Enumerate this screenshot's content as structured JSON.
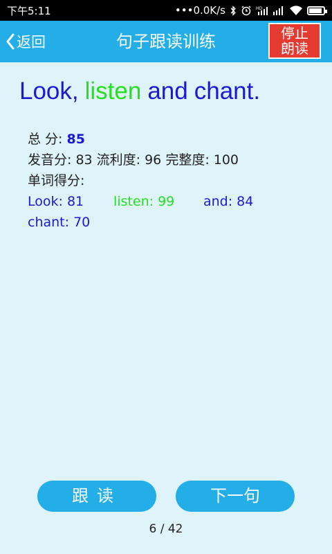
{
  "status_bar": {
    "time": "下午5:11",
    "network_speed": "0.0K/s",
    "icons": [
      "bluetooth-icon",
      "alarm-icon",
      "hd-signal-icon",
      "signal-icon",
      "wifi-icon",
      "battery-icon"
    ],
    "battery_level": 0.9
  },
  "header": {
    "back_label": "返回",
    "title": "句子跟读训练",
    "stop_line1": "停止",
    "stop_line2": "朗读"
  },
  "sentence": {
    "words": [
      {
        "text": "Look,",
        "color": "#1a1ad6"
      },
      {
        "text": "listen",
        "color": "#26e01e"
      },
      {
        "text": "and",
        "color": "#1a1ad6"
      },
      {
        "text": "chant.",
        "color": "#1a1ad6"
      }
    ]
  },
  "scores": {
    "total_label": "总 分: ",
    "total_value": "85",
    "detail": "发音分: 83 流利度: 96 完整度: 100",
    "word_label": "单词得分:",
    "word_scores": [
      {
        "text": "Look: 81",
        "color": "#1a1ad6"
      },
      {
        "text": "listen: 99",
        "color": "#26e01e"
      },
      {
        "text": "and: 84",
        "color": "#1a1ad6"
      },
      {
        "text": "chant: 70",
        "color": "#1a1ad6"
      }
    ]
  },
  "footer": {
    "follow_label": "跟读",
    "next_label": "下一句",
    "page_indicator": "6 / 42"
  },
  "colors": {
    "accent": "#23aee8",
    "background": "#dff3fb",
    "stop_red": "#e53a2f"
  }
}
